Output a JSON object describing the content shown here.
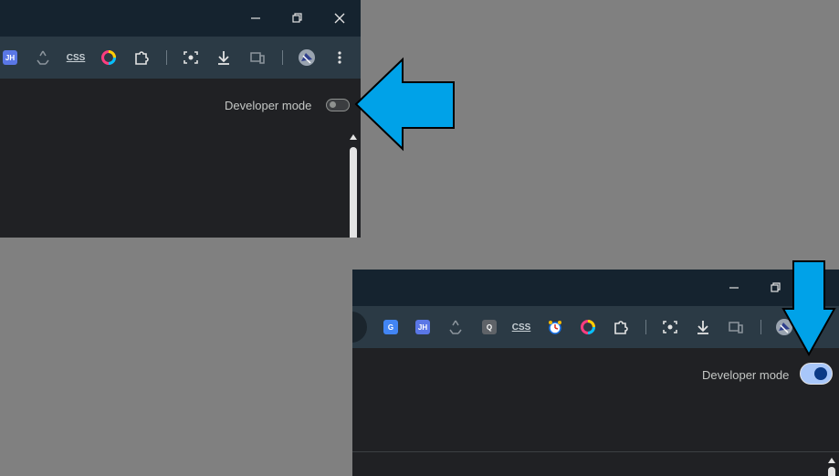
{
  "top_panel": {
    "developer_mode_label": "Developer mode",
    "developer_mode_enabled": false,
    "toolbar_icons": [
      "jh-badge-icon",
      "recycle-icon",
      "css-icon",
      "color-ring-icon",
      "puzzle-extensions-icon",
      "screenshot-icon",
      "download-icon",
      "devices-icon",
      "avatar",
      "more-menu-icon"
    ],
    "jh_text": "JH",
    "css_text": "css"
  },
  "bottom_panel": {
    "developer_mode_label": "Developer mode",
    "developer_mode_enabled": true,
    "toolbar_icons": [
      "translate-icon",
      "jh-badge-icon",
      "recycle-icon",
      "q-badge-icon",
      "css-icon",
      "alarm-icon",
      "color-ring-icon",
      "puzzle-extensions-icon",
      "screenshot-icon",
      "download-icon",
      "devices-icon",
      "avatar"
    ],
    "jh_text": "JH",
    "q_text": "Q",
    "css_text": "css",
    "translate_text": "G"
  },
  "colors": {
    "background": "#808080",
    "titlebar": "#15232f",
    "toolbar": "#2b3a45",
    "page": "#202124",
    "annotation_arrow": "#00a2e8",
    "toggle_on": "#a8c7fa"
  }
}
